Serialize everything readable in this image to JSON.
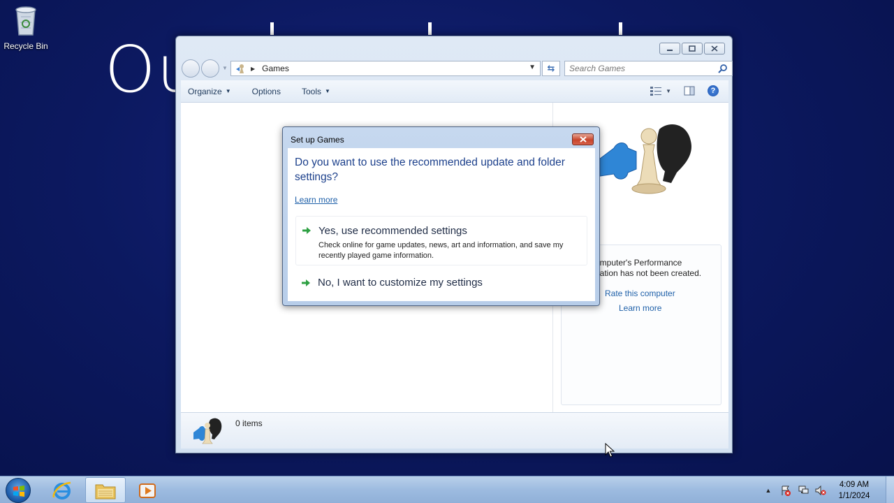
{
  "desktop": {
    "recycle_bin_label": "Recycle Bin",
    "wallpaper_text": "Ou"
  },
  "explorer": {
    "address": {
      "location": "Games"
    },
    "search": {
      "placeholder": "Search Games"
    },
    "toolbar": {
      "organize_label": "Organize",
      "options_label": "Options",
      "tools_label": "Tools"
    },
    "performance_panel": {
      "message_line1": "omputer's Performance",
      "message_line2": "nation has not been created.",
      "rate_link": "Rate this computer",
      "learn_more_link": "Learn more"
    },
    "details": {
      "item_count": "0 items"
    }
  },
  "dialog": {
    "title": "Set up Games",
    "question": "Do you want to use the recommended update and folder settings?",
    "learn_more": "Learn more",
    "option_yes": {
      "title": "Yes, use recommended settings",
      "description": "Check online for game updates, news, art and information, and save my recently played game information."
    },
    "option_no": {
      "title": "No, I want to customize my settings"
    }
  },
  "taskbar": {
    "clock": {
      "time": "4:09 AM",
      "date": "1/1/2024"
    }
  },
  "colors": {
    "desktop_bg": "#0c1960",
    "link": "#1d5fa8",
    "dialog_heading": "#1b3f8b",
    "close_red": "#c8452b",
    "option_arrow": "#2ea043"
  }
}
